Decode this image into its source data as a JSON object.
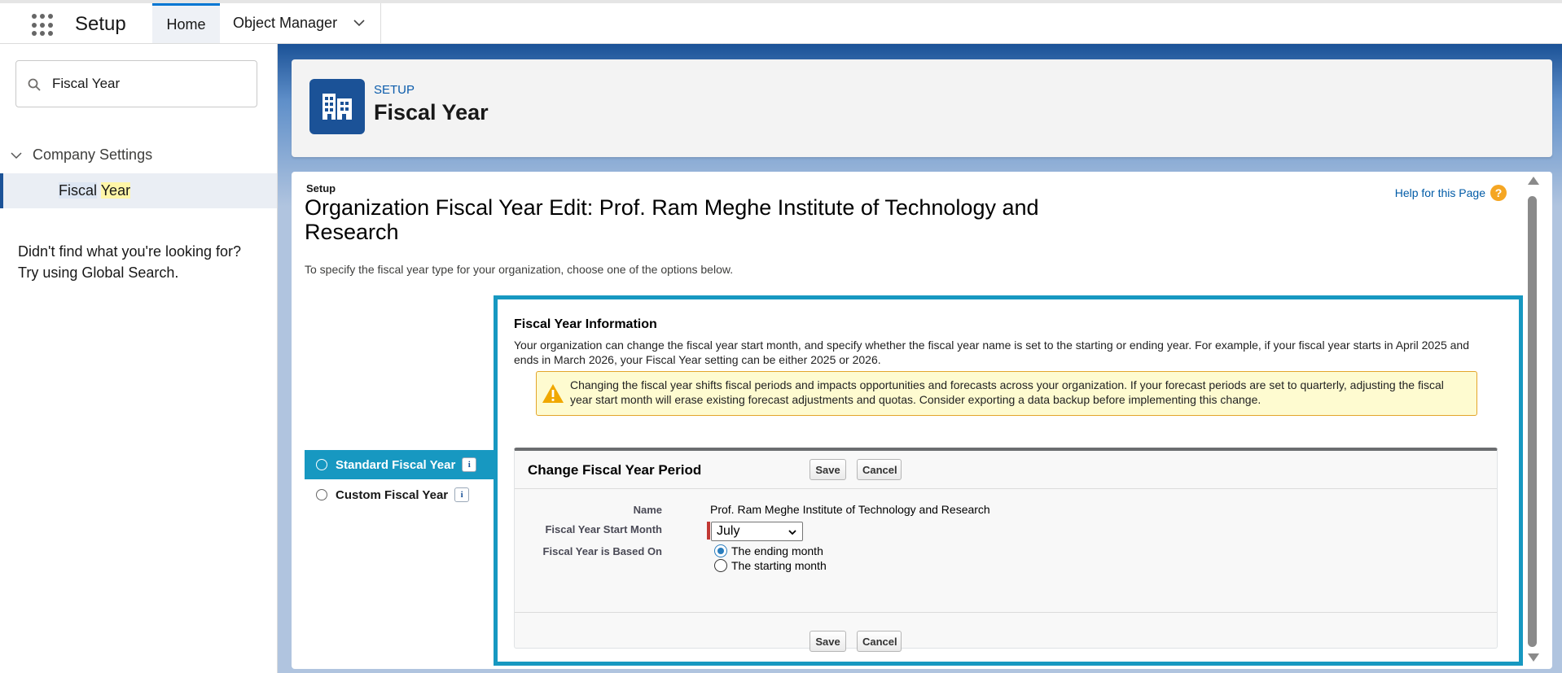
{
  "topbar": {
    "app_name": "Setup",
    "tabs": [
      {
        "label": "Home"
      },
      {
        "label": "Object Manager"
      }
    ]
  },
  "sidebar": {
    "search": {
      "value": "Fiscal Year"
    },
    "group": {
      "label": "Company Settings"
    },
    "item": {
      "label_part1": "Fiscal",
      "label_part2": "Year"
    },
    "not_found_line1": "Didn't find what you're looking for?",
    "not_found_line2": "Try using Global Search."
  },
  "header": {
    "eyebrow": "SETUP",
    "title": "Fiscal Year"
  },
  "main": {
    "setup_label": "Setup",
    "title": "Organization Fiscal Year Edit: Prof. Ram Meghe Institute of Technology and Research",
    "help_link": "Help for this Page",
    "instructions": "To specify the fiscal year type for your organization, choose one of the options below.",
    "options": [
      {
        "label": "Standard Fiscal Year",
        "selected": true
      },
      {
        "label": "Custom Fiscal Year",
        "selected": false
      }
    ],
    "info": {
      "heading": "Fiscal Year Information",
      "text": "Your organization can change the fiscal year start month, and specify whether the fiscal year name is set to the starting or ending year. For example, if your fiscal year starts in April 2025 and ends in March 2026, your Fiscal Year setting can be either 2025 or 2026."
    },
    "warning": "Changing the fiscal year shifts fiscal periods and impacts opportunities and forecasts across your organization. If your forecast periods are set to quarterly, adjusting the fiscal year start month will erase existing forecast adjustments and quotas. Consider exporting a data backup before implementing this change.",
    "form": {
      "title": "Change Fiscal Year Period",
      "save_label": "Save",
      "cancel_label": "Cancel",
      "name_label": "Name",
      "name_value": "Prof. Ram Meghe Institute of Technology and Research",
      "start_month_label": "Fiscal Year Start Month",
      "start_month_value": "July",
      "based_on_label": "Fiscal Year is Based On",
      "based_on_options": [
        {
          "label": "The ending month",
          "selected": true
        },
        {
          "label": "The starting month",
          "selected": false
        }
      ]
    }
  },
  "colors": {
    "brand": "#1b5297",
    "accent": "#1798c1",
    "warning_bg": "#fefbd0"
  }
}
